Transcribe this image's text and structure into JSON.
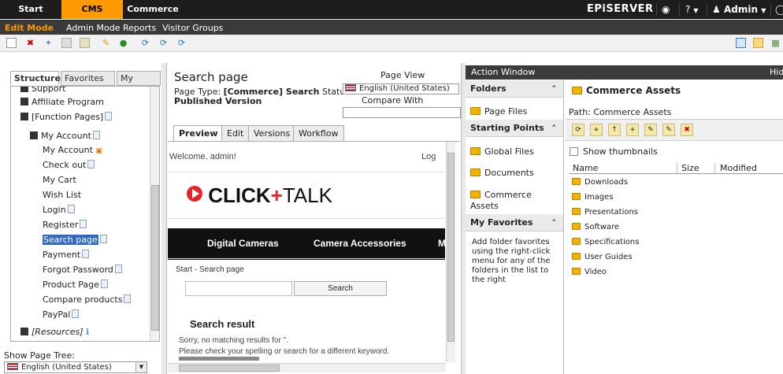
{
  "topbar": {
    "tabs": [
      "Start",
      "CMS",
      "Commerce"
    ],
    "brand": "EPiSERVER",
    "help": "?",
    "user": "Admin"
  },
  "modebar": {
    "items": [
      "Edit Mode",
      "Admin Mode",
      "Reports",
      "Visitor Groups"
    ]
  },
  "left": {
    "tabs": [
      "Structure",
      "Favorites",
      "My Tasks"
    ],
    "tree": [
      {
        "label": "Support"
      },
      {
        "label": "Affiliate Program"
      },
      {
        "label": "[Function Pages]"
      },
      {
        "label": "My Account"
      },
      {
        "label": "My Account"
      },
      {
        "label": "Check out"
      },
      {
        "label": "My Cart"
      },
      {
        "label": "Wish List"
      },
      {
        "label": "Login"
      },
      {
        "label": "Register"
      },
      {
        "label": "Search page"
      },
      {
        "label": "Payment"
      },
      {
        "label": "Forgot Password"
      },
      {
        "label": "Product Page"
      },
      {
        "label": "Compare products"
      },
      {
        "label": "PayPal"
      },
      {
        "label": "[Resources]"
      }
    ],
    "show_tree_label": "Show Page Tree:",
    "language_select": "English (United States)"
  },
  "middle": {
    "title": "Search page",
    "page_view": "Page View",
    "page_type_label": "Page Type:",
    "page_type_value": "[Commerce] Search",
    "status_label": "Status:",
    "language": "English (United States)",
    "published": "Published Version",
    "compare_with": "Compare With",
    "tabs": [
      "Preview",
      "Edit",
      "Versions",
      "Workflow"
    ],
    "preview": {
      "welcome": "Welcome, admin!",
      "log": "Log",
      "logo_click": "CLICK",
      "logo_plus": "+",
      "logo_talk": "TALK",
      "nav": [
        "Digital Cameras",
        "Camera Accessories",
        "M"
      ],
      "breadcrumb": "Start - Search page",
      "search_button": "Search",
      "result_title": "Search result",
      "no_match": "Sorry, no matching results for ''.",
      "hint": "Please check your spelling or search for a different keyword."
    }
  },
  "action": {
    "title": "Action Window",
    "hide": "Hid",
    "sections": [
      {
        "label": "Folders"
      },
      {
        "label": "Starting Points"
      },
      {
        "label": "My Favorites"
      }
    ],
    "folders_items": [
      "Page Files"
    ],
    "starting_items": [
      "Global Files",
      "Documents",
      "Commerce Assets"
    ],
    "favorites_text": "Add folder favorites using the right-click menu for any of the folders in the list to the right",
    "assets_title": "Commerce Assets",
    "path": "Path: Commerce Assets",
    "show_thumbnails": "Show thumbnails",
    "columns": [
      "Name",
      "Size",
      "Modified"
    ],
    "files": [
      "Downloads",
      "Images",
      "Presentations",
      "Software",
      "Specifications",
      "User Guides",
      "Video"
    ]
  },
  "colors": {
    "accent": "#ff9900",
    "topbar": "#1d1d1d",
    "highlight": "#316ac5",
    "logo_red": "#e8222b"
  }
}
